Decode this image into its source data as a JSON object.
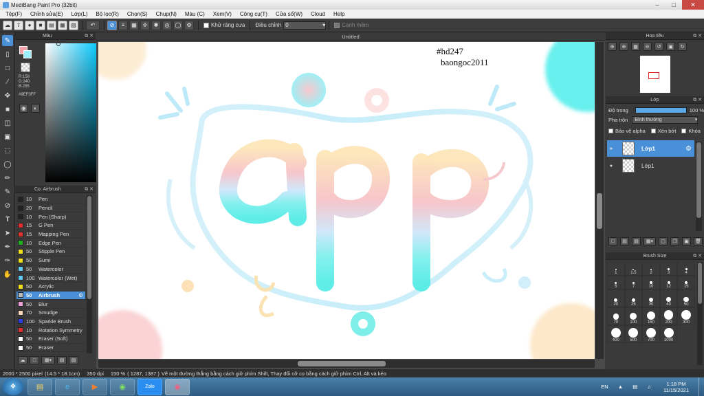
{
  "window": {
    "title": "MediBang Paint Pro (32bit)"
  },
  "menu": [
    "Tệp(F)",
    "Chỉnh sửa(E)",
    "Lớp(L)",
    "Bộ lọc(R)",
    "Chọn(S)",
    "Chụp(N)",
    "Màu (C)",
    "Xem(V)",
    "Công cụ(T)",
    "Cửa sổ(W)",
    "Cloud",
    "Help"
  ],
  "toolbar": {
    "antialias_label": "Khử răng cưa",
    "correction_label": "Điều chỉnh",
    "correction_value": "0",
    "edge_label": "Cạnh mềm"
  },
  "color_panel": {
    "title": "Màu",
    "rgb": "R:158\nG:240\nB:255",
    "hex": "#9EF0FF",
    "colors": {
      "foreground": "#f3a0a8",
      "background": "#9EF0FF"
    }
  },
  "brush_panel": {
    "title": "Cọ: Airbrush",
    "brushes": [
      {
        "size": "10",
        "name": "Pen",
        "color": "#222222"
      },
      {
        "size": "20",
        "name": "Pencil",
        "color": "#222222"
      },
      {
        "size": "10",
        "name": "Pen (Sharp)",
        "color": "#222222"
      },
      {
        "size": "15",
        "name": "G Pen",
        "color": "#e03030"
      },
      {
        "size": "15",
        "name": "Mapping Pen",
        "color": "#e03030"
      },
      {
        "size": "10",
        "name": "Edge Pen",
        "color": "#20b020"
      },
      {
        "size": "50",
        "name": "Stipple Pen",
        "color": "#f0e020"
      },
      {
        "size": "50",
        "name": "Sumi",
        "color": "#f0e020"
      },
      {
        "size": "50",
        "name": "Watercolor",
        "color": "#60c8f0"
      },
      {
        "size": "100",
        "name": "Watercolor (Wet)",
        "color": "#60c8f0"
      },
      {
        "size": "50",
        "name": "Acrylic",
        "color": "#f0e020"
      },
      {
        "size": "50",
        "name": "Airbrush",
        "color": "#bbbbbb"
      },
      {
        "size": "50",
        "name": "Blur",
        "color": "#f0a0d8"
      },
      {
        "size": "70",
        "name": "Smudge",
        "color": "#f8d8b8"
      },
      {
        "size": "100",
        "name": "Sparkle Brush",
        "color": "#3040e0"
      },
      {
        "size": "10",
        "name": "Rotation Symmetry",
        "color": "#e03030"
      },
      {
        "size": "50",
        "name": "Eraser (Soft)",
        "color": "#ffffff"
      },
      {
        "size": "50",
        "name": "Eraser",
        "color": "#ffffff"
      }
    ],
    "selected_index": 11
  },
  "canvas": {
    "tab_title": "Untitled",
    "watermark_line1": "#hd247",
    "watermark_line2": "baongoc2011"
  },
  "navigator": {
    "title": "Hoa tiêu"
  },
  "layer_panel": {
    "title": "Lớp",
    "opacity_label": "Độ trong",
    "opacity_value": "100 %",
    "blend_label": "Pha trộn",
    "blend_value": "Bình thường",
    "protect_alpha": "Bảo vệ alpha",
    "clipping": "Xén bớt",
    "lock": "Khóa",
    "layers": [
      {
        "name": "Lớp1",
        "selected": true
      },
      {
        "name": "Lớp1",
        "selected": false
      }
    ]
  },
  "brush_size_panel": {
    "title": "Brush Size",
    "sizes": [
      "1",
      "1.5",
      "2",
      "3",
      "4",
      "5",
      "7",
      "10",
      "12",
      "15",
      "20",
      "25",
      "30",
      "40",
      "50",
      "70",
      "100",
      "150",
      "200",
      "300",
      "400",
      "500",
      "700",
      "1000"
    ]
  },
  "status": {
    "dimensions": "2000 * 2500 pixel",
    "physical": "(14.5 * 18.1cm)",
    "dpi": "350 dpi",
    "zoom": "150 %",
    "coords": "( 1287, 1387 )",
    "hint": "Vẽ một đường thẳng bằng cách giữ phím Shift, Thay đổi cỡ cọ bằng cách giữ phím Ctrl, Alt và kéo"
  },
  "taskbar": {
    "lang": "EN",
    "time": "1:18 PM",
    "date": "11/15/2021",
    "zalo_label": "Zalo"
  }
}
